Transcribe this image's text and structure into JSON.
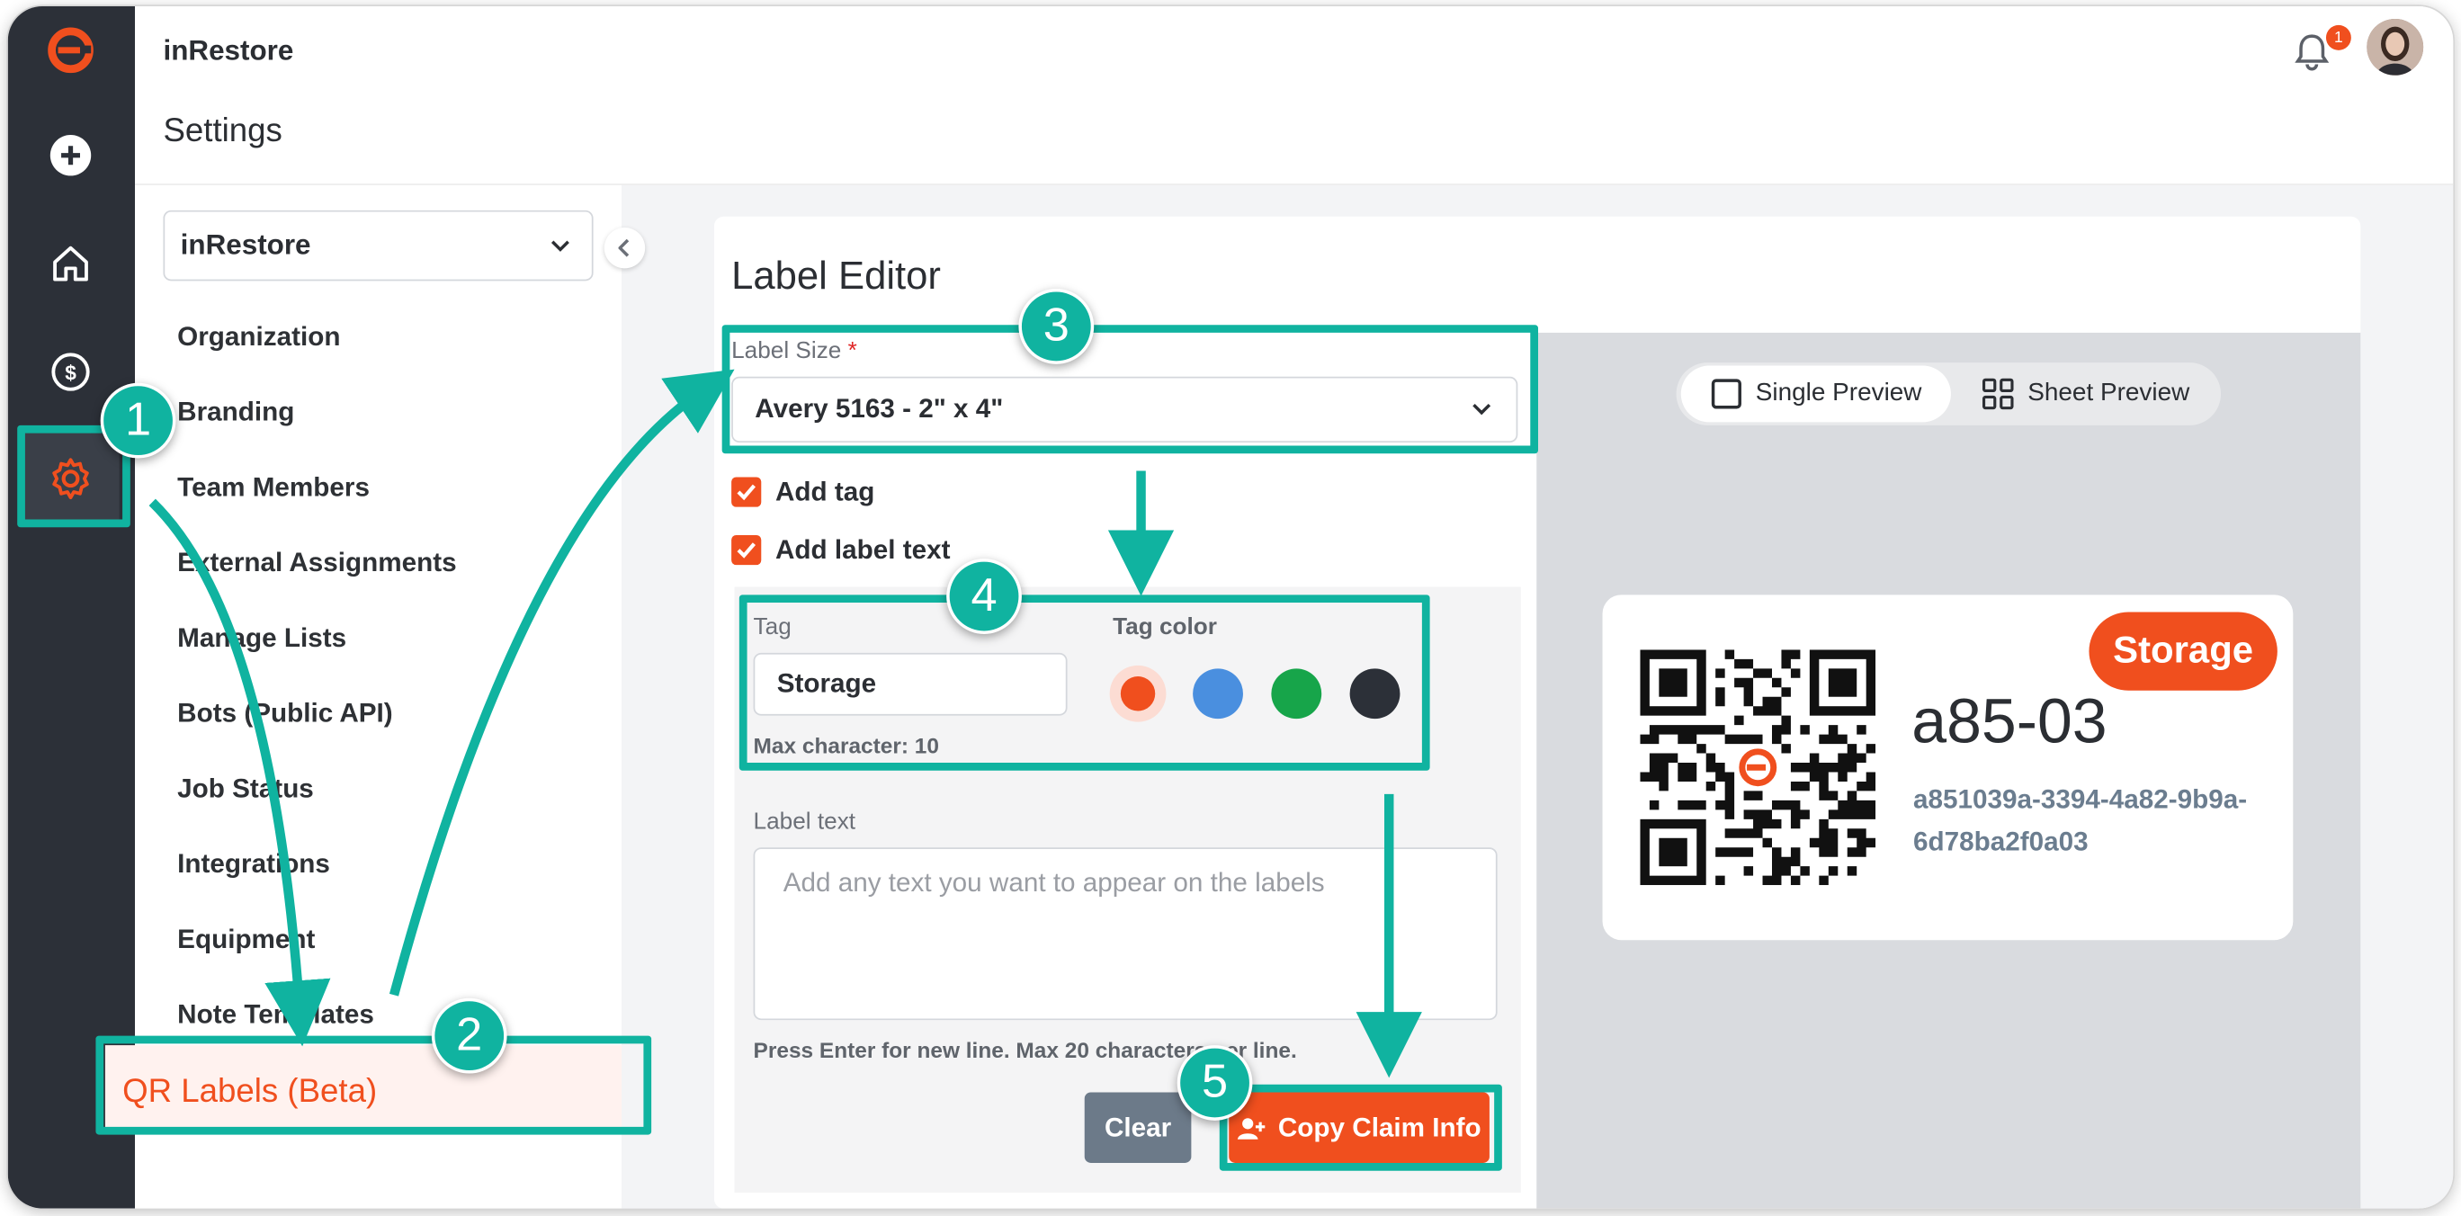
{
  "app": {
    "brand": "inRestore",
    "page_title": "Settings",
    "notification_count": "1"
  },
  "sidebar": {
    "org_select": "inRestore",
    "items": [
      {
        "label": "Organization"
      },
      {
        "label": "Branding"
      },
      {
        "label": "Team Members"
      },
      {
        "label": "External Assignments"
      },
      {
        "label": "Manage Lists"
      },
      {
        "label": "Bots (Public API)"
      },
      {
        "label": "Job Status"
      },
      {
        "label": "Integrations"
      },
      {
        "label": "Equipment"
      },
      {
        "label": "Note Templates"
      }
    ],
    "active_item": "QR Labels (Beta)"
  },
  "editor": {
    "title": "Label Editor",
    "label_size_label": "Label Size",
    "required_mark": "*",
    "label_size_value": "Avery 5163 - 2\" x 4\"",
    "add_tag_label": "Add tag",
    "add_tag_checked": true,
    "add_label_text_label": "Add label text",
    "add_label_text_checked": true,
    "tag_label": "Tag",
    "tag_value": "Storage",
    "tag_color_label": "Tag color",
    "tag_colors": [
      "#f04f1e",
      "#4a8fdf",
      "#17a54a",
      "#2c3038"
    ],
    "selected_tag_color": "#f04f1e",
    "max_char_hint": "Max character: 10",
    "label_text_label": "Label text",
    "label_text_placeholder": "Add any text you want to appear on the labels",
    "label_text_hint": "Press Enter for new line. Max 20 characters per line.",
    "clear_button": "Clear",
    "copy_button": "Copy Claim Info"
  },
  "preview": {
    "single_label": "Single Preview",
    "sheet_label": "Sheet Preview",
    "tag": "Storage",
    "code": "a85-03",
    "uuid_line1": "a851039a-3394-4a82-9b9a-",
    "uuid_line2": "6d78ba2f0a03"
  },
  "annotations": {
    "step1": "1",
    "step2": "2",
    "step3": "3",
    "step4": "4",
    "step5": "5"
  },
  "colors": {
    "accent": "#f04f1e",
    "rail": "#2c3038",
    "annotation": "#10b3a0"
  }
}
